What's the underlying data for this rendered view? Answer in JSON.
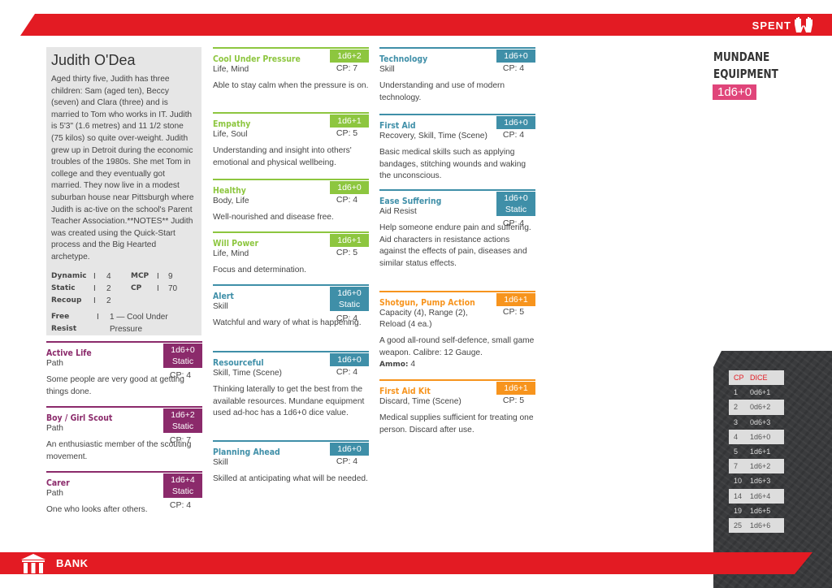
{
  "header": {
    "spent_label": "SPENT",
    "spent_icon": "raised-hands-icon"
  },
  "footer": {
    "bank_label": "BANK",
    "bank_icon": "bank-building-icon"
  },
  "colors": {
    "banner": "#e31b23",
    "path": "#8b2a6b",
    "attribute": "#8dc63f",
    "skill": "#3f8fa8",
    "equipment": "#f7941d",
    "mundane": "#e0457a"
  },
  "mundane": {
    "title_line1": "MUNDANE",
    "title_line2": "EQUIPMENT",
    "dice": "1d6+0"
  },
  "dice_table": {
    "headers": [
      "CP",
      "DICE"
    ],
    "rows": [
      [
        "1",
        "0d6+1"
      ],
      [
        "2",
        "0d6+2"
      ],
      [
        "3",
        "0d6+3"
      ],
      [
        "4",
        "1d6+0"
      ],
      [
        "5",
        "1d6+1"
      ],
      [
        "7",
        "1d6+2"
      ],
      [
        "10",
        "1d6+3"
      ],
      [
        "14",
        "1d6+4"
      ],
      [
        "19",
        "1d6+5"
      ],
      [
        "25",
        "1d6+6"
      ]
    ]
  },
  "character": {
    "name": "Judith O'Dea",
    "bio": "Aged thirty five, Judith has three children: Sam (aged ten), Beccy (seven) and Clara (three) and is married to Tom who works in IT. Judith is 5'3\" (1.6 metres) and 11 1/2 stone (75 kilos) so quite over-weight. Judith grew up in Detroit during the economic troubles of the 1980s. She met Tom in college and they eventually got married. They now live in a modest suburban house near Pittsburgh where Judith is ac-tive on the school's Parent Teacher Association.**NOTES** Judith was created using the Quick-Start process and the Big Hearted archetype.",
    "stats": [
      {
        "label": "Dynamic",
        "value": "4",
        "label2": "MCP",
        "value2": "9"
      },
      {
        "label": "Static",
        "value": "2",
        "label2": "CP",
        "value2": "70"
      },
      {
        "label": "Recoup",
        "value": "2",
        "label2": "",
        "value2": ""
      }
    ],
    "free_resist_label": "Free Resist",
    "free_resist_value": "1 — Cool Under Pressure",
    "separator": "I"
  },
  "cards": [
    {
      "title": "Active Life",
      "type": "Path",
      "dice": "1d6+0",
      "static": "Static",
      "cp": "CP: 4",
      "desc": "Some people are very good at getting things done.",
      "color": "#8b2a6b"
    },
    {
      "title": "Boy / Girl Scout",
      "type": "Path",
      "dice": "1d6+2",
      "static": "Static",
      "cp": "CP: 7",
      "desc": "An enthusiastic member of the scouting movement.",
      "color": "#8b2a6b"
    },
    {
      "title": "Carer",
      "type": "Path",
      "dice": "1d6+4",
      "static": "Static",
      "cp": "CP: 4",
      "desc": "One who looks after others.",
      "color": "#8b2a6b"
    },
    {
      "title": "Cool Under Pressure",
      "type": "Life, Mind",
      "dice": "1d6+2",
      "cp": "CP: 7",
      "desc": "Able to stay calm when the pressure is on.",
      "color": "#8dc63f"
    },
    {
      "title": "Empathy",
      "type": "Life, Soul",
      "dice": "1d6+1",
      "cp": "CP: 5",
      "desc": "Understanding and insight into others' emotional and physical wellbeing.",
      "color": "#8dc63f"
    },
    {
      "title": "Healthy",
      "type": "Body, Life",
      "dice": "1d6+0",
      "cp": "CP: 4",
      "desc": "Well-nourished and disease free.",
      "color": "#8dc63f"
    },
    {
      "title": "Will Power",
      "type": "Life, Mind",
      "dice": "1d6+1",
      "cp": "CP: 5",
      "desc": "Focus and determination.",
      "color": "#8dc63f"
    },
    {
      "title": "Alert",
      "type": "Skill",
      "dice": "1d6+0",
      "static": "Static",
      "cp": "CP: 4",
      "desc": "Watchful and wary of what is happening.",
      "color": "#3f8fa8"
    },
    {
      "title": "Resourceful",
      "type": "Skill, Time (Scene)",
      "dice": "1d6+0",
      "cp": "CP: 4",
      "desc": "Thinking laterally to get the best from the available resources. Mundane equipment used ad-hoc has a 1d6+0 dice value.",
      "color": "#3f8fa8"
    },
    {
      "title": "Planning Ahead",
      "type": "Skill",
      "dice": "1d6+0",
      "cp": "CP: 4",
      "desc": "Skilled at anticipating what will be needed.",
      "color": "#3f8fa8"
    },
    {
      "title": "Technology",
      "type": "Skill",
      "dice": "1d6+0",
      "cp": "CP: 4",
      "desc": "Understanding and use of modern technology.",
      "color": "#3f8fa8"
    },
    {
      "title": "First Aid",
      "type": "Recovery, Skill, Time (Scene)",
      "dice": "1d6+0",
      "cp": "CP: 4",
      "desc": "Basic medical skills such as applying bandages, stitching wounds and waking the unconscious.",
      "color": "#3f8fa8"
    },
    {
      "title": "Ease Suffering",
      "type": "Aid Resist",
      "dice": "1d6+0",
      "static": "Static",
      "cp": "CP: 4",
      "desc": "Help someone endure pain and suffering. Aid characters in resistance actions against the effects of pain, diseases and similar status effects.",
      "color": "#3f8fa8"
    },
    {
      "title": "Shotgun, Pump Action",
      "type": "Capacity (4), Range (2), Reload (4 ea.)",
      "dice": "1d6+1",
      "cp": "CP: 5",
      "desc": "A good all-round self-defence, small game weapon. Calibre: 12 Gauge.",
      "extra_label": "Ammo:",
      "extra_value": "4",
      "color": "#f7941d"
    },
    {
      "title": "First Aid Kit",
      "type": "Discard, Time (Scene)",
      "dice": "1d6+1",
      "cp": "CP: 5",
      "desc": "Medical supplies sufficient for treating one person. Discard after use.",
      "color": "#f7941d"
    }
  ]
}
